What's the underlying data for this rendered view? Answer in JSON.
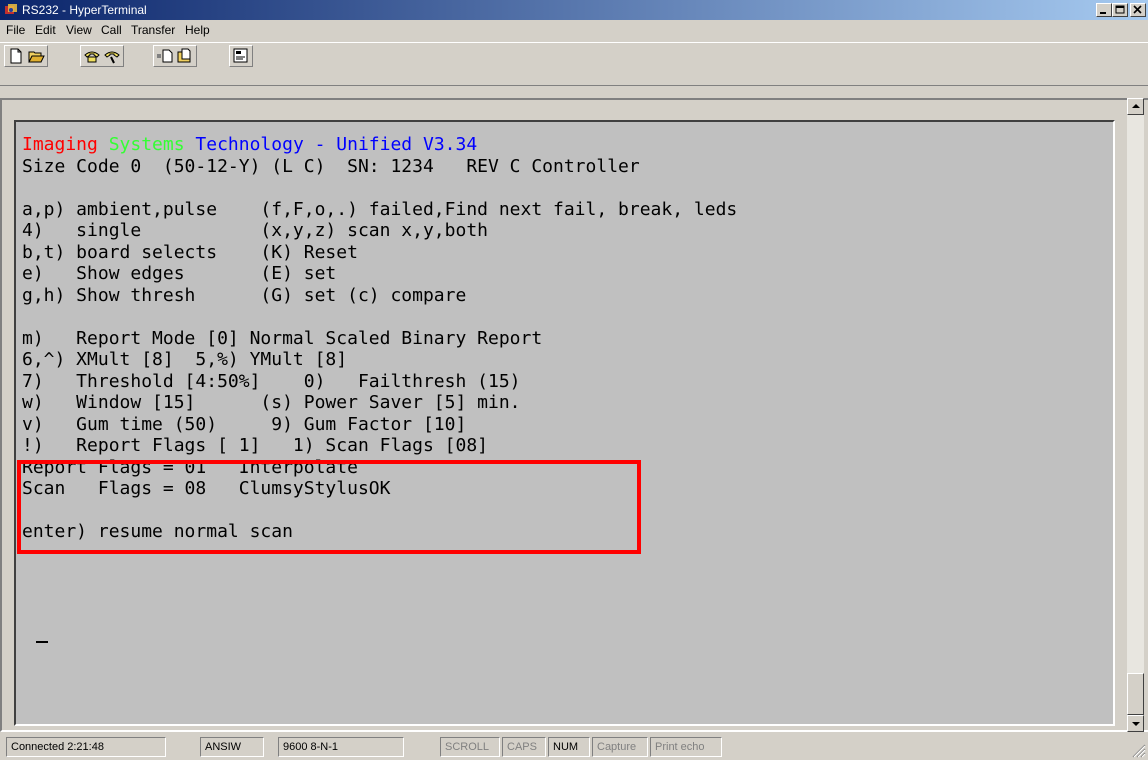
{
  "window": {
    "title": "RS232 - HyperTerminal",
    "accent_gradient": [
      "#0a246a",
      "#a6caf0"
    ]
  },
  "menu": [
    "File",
    "Edit",
    "View",
    "Call",
    "Transfer",
    "Help"
  ],
  "toolbar": {
    "buttons": [
      {
        "icon": "new-icon"
      },
      {
        "icon": "open-icon"
      },
      {
        "icon": "call-icon"
      },
      {
        "icon": "disconnect-icon"
      },
      {
        "icon": "send-icon"
      },
      {
        "icon": "receive-icon"
      },
      {
        "icon": "properties-icon"
      }
    ]
  },
  "terminal": {
    "header": {
      "word1": "Imaging",
      "word2": "Systems",
      "word3": "Technology - Unified V3.34"
    },
    "lines": [
      "Size Code 0  (50-12-Y) (L C)  SN: 1234   REV C Controller",
      "",
      "a,p) ambient,pulse    (f,F,o,.) failed,Find next fail, break, leds",
      "4)   single           (x,y,z) scan x,y,both",
      "b,t) board selects    (K) Reset",
      "e)   Show edges       (E) set",
      "g,h) Show thresh      (G) set (c) compare",
      "",
      "m)   Report Mode [0] Normal Scaled Binary Report",
      "6,^) XMult [8]  5,%) YMult [8]",
      "7)   Threshold [4:50%]    0)   Failthresh (15)",
      "w)   Window [15]      (s) Power Saver [5] min.",
      "v)   Gum time (50)     9) Gum Factor [10]",
      "!)   Report Flags [ 1]   1) Scan Flags [08]",
      "Report Flags = 01   Interpolate",
      "Scan   Flags = 08   ClumsyStylusOK",
      "",
      "enter) resume normal scan"
    ],
    "highlight_color": "#ff0000",
    "colors": {
      "red": "#ff0000",
      "green": "#33ff33",
      "blue": "#0000ff"
    }
  },
  "status": {
    "connected": "Connected 2:21:48",
    "emulation": "ANSIW",
    "port": "9600 8-N-1",
    "scroll": "SCROLL",
    "caps": "CAPS",
    "num": "NUM",
    "capture": "Capture",
    "print_echo": "Print echo"
  }
}
